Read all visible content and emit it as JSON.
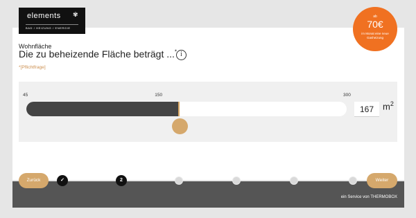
{
  "header": {
    "logo_text": "elements",
    "logo_tagline": "BAD / HEIZUNG / ENERGIE"
  },
  "promo_badge": {
    "prefix": "ab",
    "amount": "70€",
    "text": "im Monat eine neue Gasheizung"
  },
  "question": {
    "category": "Wohnfläche",
    "title": "Die zu beheizende Fläche beträgt ...",
    "required_marker": "*",
    "required_note": "*[Pflichtfrage]"
  },
  "slider": {
    "min": 45,
    "max": 300,
    "value": 167,
    "tick_labels": [
      "45",
      "150",
      "300"
    ],
    "input_value": "167",
    "unit": "m",
    "unit_sup": "2",
    "fill_color": "#444444",
    "accent_color": "#d5a86c"
  },
  "navigation": {
    "back_label": "Zurück",
    "next_label": "Weiter",
    "steps": [
      {
        "label": "✓",
        "state": "done"
      },
      {
        "label": "2",
        "state": "current"
      },
      {
        "label": "",
        "state": "todo"
      },
      {
        "label": "",
        "state": "todo"
      },
      {
        "label": "",
        "state": "todo"
      },
      {
        "label": "",
        "state": "todo"
      }
    ]
  },
  "footer": {
    "service_text": "ein Service von THERMOBOX"
  }
}
